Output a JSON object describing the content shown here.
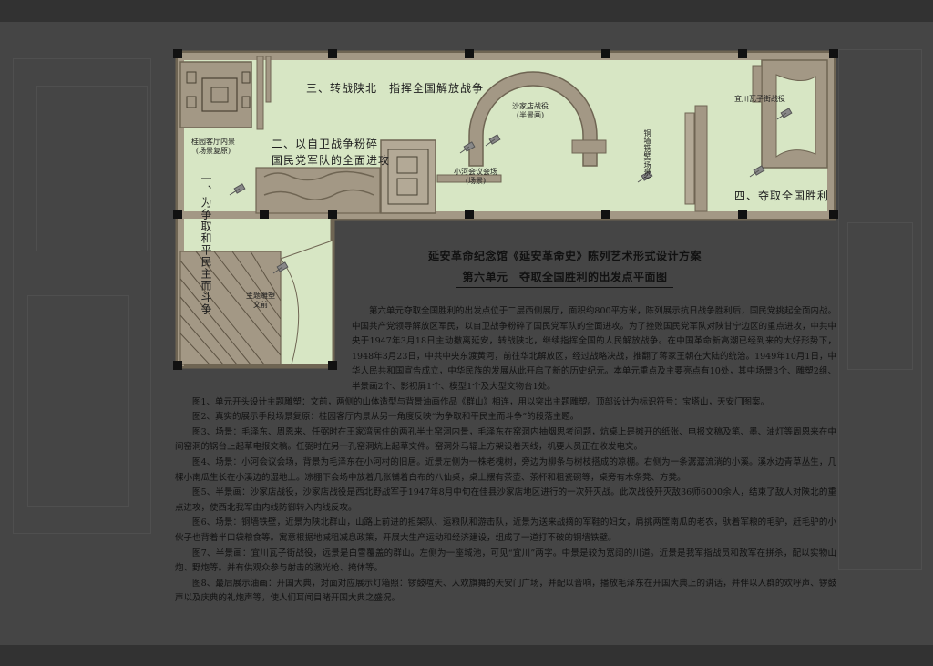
{
  "plan": {
    "areas": {
      "area1": "一、为争取和平民主而斗争",
      "area2_line1": "二、以自卫战争粉碎",
      "area2_line2": "国民党军队的全面进攻",
      "area3": "三、转战陕北　指挥全国解放战争",
      "area4": "四、夺取全国胜利"
    },
    "spots": {
      "guilin_line1": "桂园客厅内景",
      "guilin_line2": "(场景复原)",
      "xiaohe_line1": "小河会议会场",
      "xiaohe_line2": "(场景)",
      "shajiadian_line1": "沙家店战役",
      "shajiadian_line2": "(半景画)",
      "tongqiang": "铜墙铁壁(场景)",
      "yichuan": "宜川瓦子街战役",
      "sculpture_line1": "主题雕塑",
      "sculpture_line2": "文前"
    },
    "colors": {
      "floor": "#d7e6c4",
      "wall": "#a39885",
      "wall_edge": "#6f6553",
      "column": "#111111"
    }
  },
  "title": {
    "main": "延安革命纪念馆《延安革命史》陈列艺术形式设计方案",
    "sub": "第六单元　夺取全国胜利的出发点平面图"
  },
  "description": [
    "第六单元夺取全国胜利的出发点位于二层西侧展厅，面积约800平方米，陈列展示抗日战争胜利后，国民党挑起全面内战。中国共产党领导解放区军民，以自卫战争粉碎了国民党军队的全面进攻。为了挫败国民党军队对陕甘宁边区的重点进攻，中共中央于1947年3月18日主动撤离延安，转战陕北，继续指挥全国的人民解放战争。在中国革命新高潮已经到来的大好形势下，1948年3月23日，中共中央东渡黄河，前往华北解放区，经过战略决战，推翻了蒋家王朝在大陆的统治。1949年10月1日，中华人民共和国宣告成立，中华民族的发展从此开启了新的历史纪元。本单元重点及主要亮点有10处，其中场景3个、雕塑2组、半景画2个、影视屏1个、模型1个及大型文物台1处。",
    "图1、单元开头设计主题雕塑：文前，两侧的山体造型与背景油画作品《群山》相连，用以突出主题雕塑。顶部设计为标识符号：宝塔山，天安门图案。",
    "图2、真实的展示手段场景复原：桂园客厅内景从另一角度反映“为争取和平民主而斗争”的段落主题。",
    "图3、场景：毛泽东、周恩来、任弼时在王家湾居住的两孔半土窑洞内景，毛泽东在窑洞内抽烟思考问题，炕桌上是摊开的纸张、电报文稿及笔、墨、油灯等周恩来在中间窑洞的锅台上起草电报文稿。任弼时在另一孔窑洞炕上起草文件。窑洞外马辐上方架设着天线，机要人员正在收发电文。",
    "图4、场景：小河会议会场，背景为毛泽东在小河村的旧居。近景左侧为一株老槐树，旁边为柳条与树枝搭成的凉棚。右侧为一条潺潺流淌的小溪。溪水边青草丛生，几棵小南瓜生长在小溪边的湿地上。凉棚下会场中放着几张铺着白布的八仙桌，桌上摆有茶壶、茶杯和粗瓷碗等，桌旁有木条凳、方凳。",
    "图5、半景画：沙家店战役，沙家店战役是西北野战军于1947年8月中旬在佳县沙家店地区进行的一次歼灭战。此次战役歼灭敌36师6000余人，结束了敌人对陕北的重点进攻，使西北我军由内线防御转入内线反攻。",
    "图6、场景：铜墙铁壁，近景为陕北群山，山路上前进的担架队、运粮队和游击队，近景为送来战摘的军鞋的妇女，肩挑两筐南瓜的老农，驮着军粮的毛驴，赶毛驴的小伙子也背着半口袋粮食等。寓意根据地减租减息政策，开展大生产运动和经济建设，组成了一道打不破的铜墙铁壁。",
    "图7、半景画：宜川瓦子街战役，远景是白雪覆盖的群山。左侧为一座城池，可见“宜川”两字。中景是较为宽阔的川道。近景是我军指战员和敌军在拼杀，配以实物山炮、野炮等。并有供观众参与射击的激光枪、掩体等。",
    "图8、最后展示油画：开国大典，对面对应展示灯箱照：锣鼓喧天、人欢旗舞的天安门广场，并配以音响，播放毛泽东在开国大典上的讲话，并伴以人群的欢呼声、锣鼓声以及庆典的礼炮声等，使人们耳闻目睹开国大典之盛况。"
  ]
}
